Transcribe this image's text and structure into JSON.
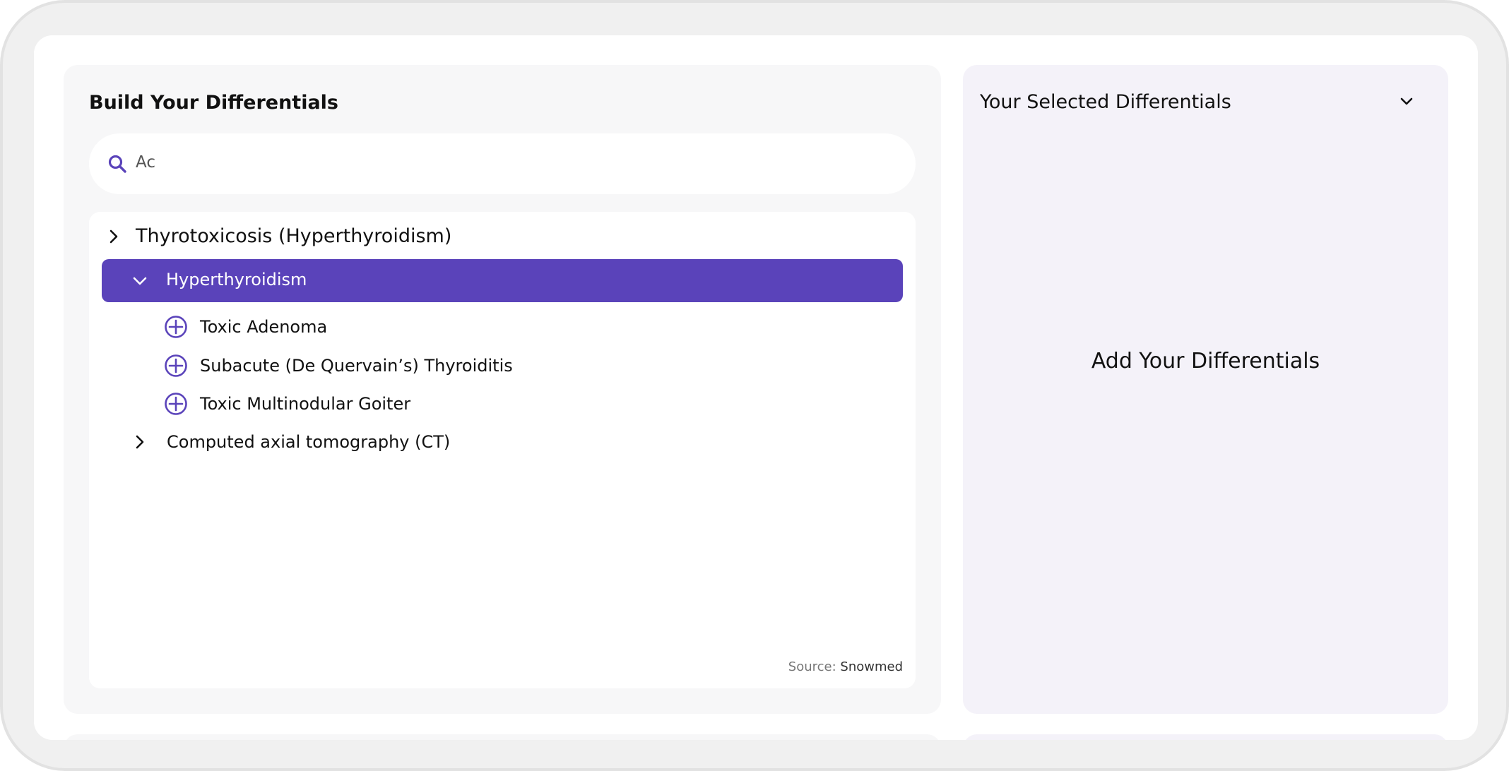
{
  "builder": {
    "title": "Build Your Differentials",
    "search": {
      "value": "Ac"
    },
    "tree": {
      "top_item": "Thyrotoxicosis (Hyperthyroidism)",
      "selected_item": "Hyperthyroidism",
      "children": [
        "Toxic Adenoma",
        "Subacute (De Quervain’s) Thyroiditis",
        "Toxic Multinodular Goiter"
      ],
      "next_item": "Computed axial tomography (CT)"
    },
    "source": {
      "label": "Source:",
      "name": "Snowmed"
    }
  },
  "selected_panel": {
    "title": "Your Selected Differentials",
    "empty_message": "Add Your Differentials"
  },
  "colors": {
    "accent": "#5a43ba",
    "left_panel_bg": "#f7f7f8",
    "right_panel_bg": "#f4f2f9"
  },
  "icons": [
    "search-icon",
    "chevron-right-icon",
    "chevron-down-icon",
    "add-circle-icon"
  ]
}
